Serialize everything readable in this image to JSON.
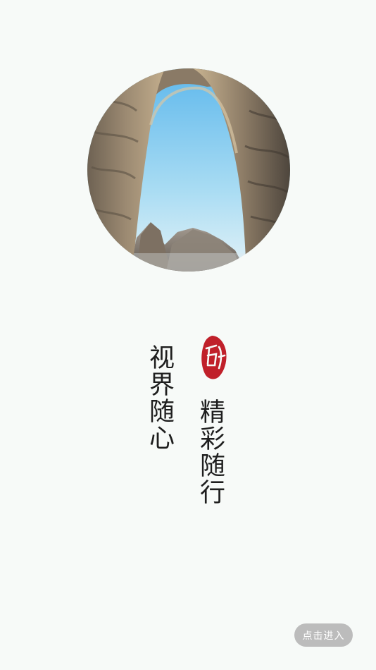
{
  "poems": {
    "left": "视界随心",
    "right": "精彩随行"
  },
  "seal": {
    "icon": "calligraphy-seal-icon",
    "color": "#c0202a"
  },
  "enter_button": {
    "label": "点击进入"
  },
  "hero": {
    "icon": "rock-arch-landscape-photo"
  }
}
